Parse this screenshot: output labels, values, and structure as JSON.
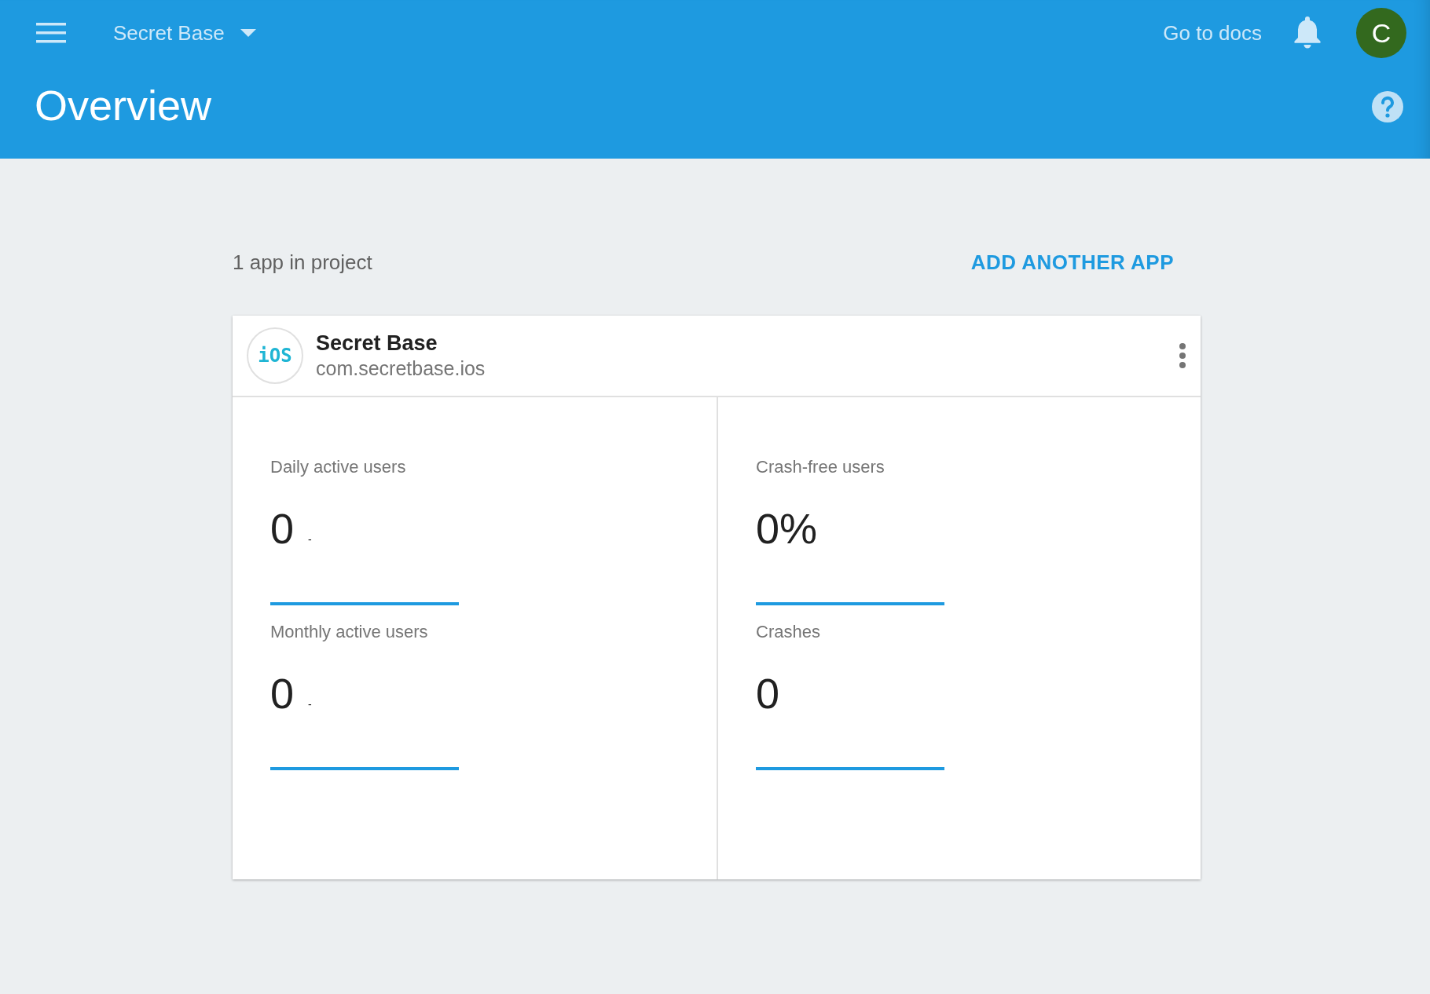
{
  "top_bar": {
    "project": "Secret Base",
    "docs_link": "Go to docs",
    "avatar_initial": "C"
  },
  "page_title": "Overview",
  "summary": "1 app in project",
  "add_app_button": "ADD ANOTHER APP",
  "app_card": {
    "platform_badge": "iOS",
    "name": "Secret Base",
    "bundle_id": "com.secretbase.ios",
    "metrics": [
      {
        "label": "Daily active users",
        "value": "0",
        "change": "-"
      },
      {
        "label": "Crash-free users",
        "value": "0%"
      },
      {
        "label": "Monthly active users",
        "value": "0",
        "change": "-"
      },
      {
        "label": "Crashes",
        "value": "0"
      }
    ]
  }
}
